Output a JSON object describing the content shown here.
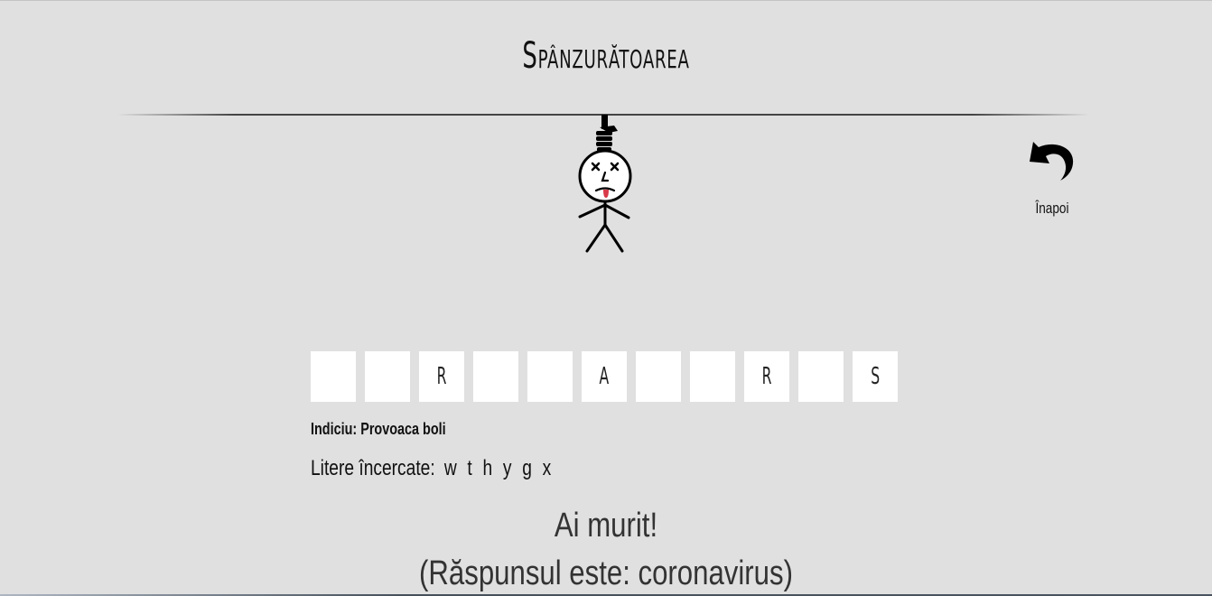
{
  "header": {
    "title": "Spânzurătoarea"
  },
  "nav": {
    "back_label": "Înapoi",
    "back_icon": "undo-arrow-icon"
  },
  "game": {
    "word_slots": [
      "",
      "",
      "R",
      "",
      "",
      "A",
      "",
      "",
      "R",
      "",
      "S"
    ],
    "hint_prefix": "Indiciu:",
    "hint_text": "Provoaca boli",
    "tried_prefix": "Litere încercate:",
    "tried_letters": "w t h y g x",
    "result_message": "Ai murit!",
    "answer_message": "(Răspunsul este: coronavirus)"
  },
  "colors": {
    "background": "#e0e0e0",
    "slot_background": "#ffffff",
    "tongue": "#d83a4a"
  }
}
